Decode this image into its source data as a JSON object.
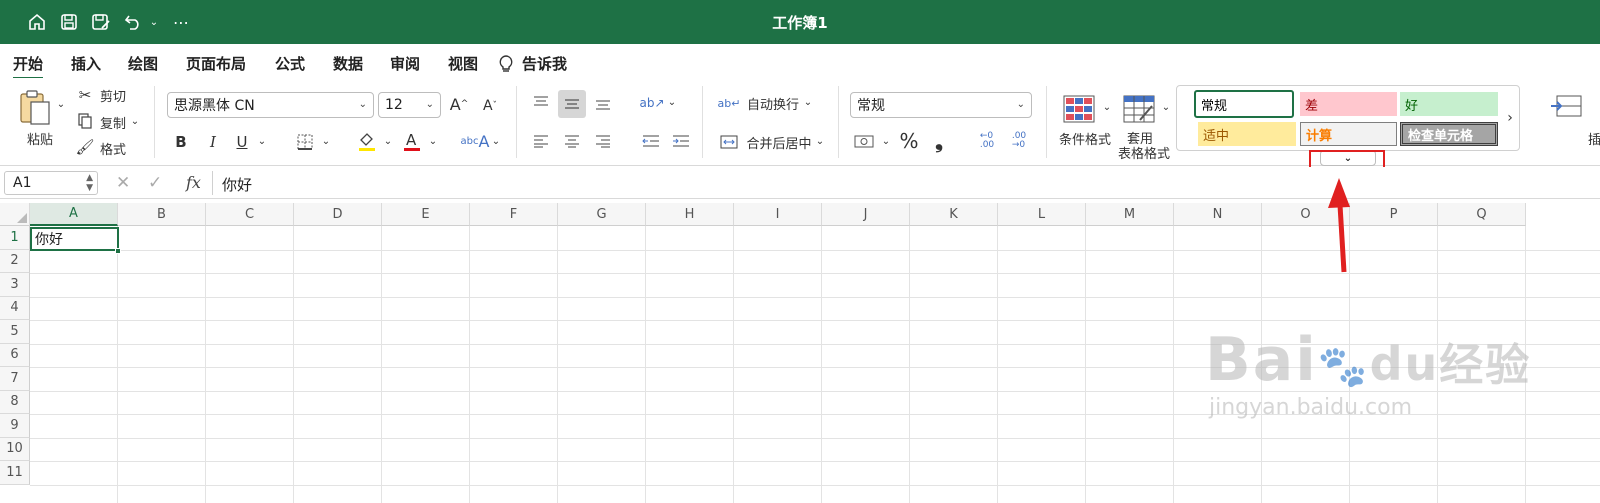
{
  "titlebar": {
    "title": "工作簿1",
    "quick_access": [
      "home-icon",
      "save-icon",
      "save-as-icon",
      "undo-icon",
      "more-icon"
    ]
  },
  "menu": {
    "tabs": [
      "开始",
      "插入",
      "绘图",
      "页面布局",
      "公式",
      "数据",
      "审阅",
      "视图"
    ],
    "tell_me": "告诉我",
    "active_index": 0
  },
  "ribbon": {
    "paste_label": "粘贴",
    "cut_label": "剪切",
    "copy_label": "复制",
    "format_painter_label": "格式",
    "font_name": "思源黑体 CN",
    "font_size": "12",
    "bold": "B",
    "italic": "I",
    "underline": "U",
    "wrap_text_label": "自动换行",
    "merge_center_label": "合并后居中",
    "number_format": "常规",
    "percent": "%",
    "comma": "❟",
    "conditional_format_label": "条件格式",
    "table_format_label_1": "套用",
    "table_format_label_2": "表格格式",
    "cell_styles": [
      {
        "label": "常规",
        "bg": "#ffffff",
        "fg": "#000000"
      },
      {
        "label": "差",
        "bg": "#ffc7ce",
        "fg": "#9c0006"
      },
      {
        "label": "好",
        "bg": "#c6efce",
        "fg": "#006100"
      },
      {
        "label": "适中",
        "bg": "#ffeb9c",
        "fg": "#9c5700"
      },
      {
        "label": "计算",
        "bg": "#f2f2f2",
        "fg": "#fa7d00"
      },
      {
        "label": "检查单元格",
        "bg": "#a5a5a5",
        "fg": "#ffffff"
      }
    ]
  },
  "formula_bar": {
    "name_box": "A1",
    "fx": "fx",
    "content": "你好"
  },
  "sheet": {
    "columns": [
      "A",
      "B",
      "C",
      "D",
      "E",
      "F",
      "G",
      "H",
      "I",
      "J",
      "K",
      "L",
      "M",
      "N",
      "O",
      "P",
      "Q"
    ],
    "rows": [
      "1",
      "2",
      "3",
      "4",
      "5",
      "6",
      "7",
      "8",
      "9",
      "10",
      "11"
    ],
    "active_cell": "A1",
    "a1_value": "你好"
  },
  "watermark": {
    "line1": "Bai",
    "line1b": "du",
    "line1c": "经验",
    "line2": "jingyan.baidu.com"
  },
  "colors": {
    "brand_green": "#1e7145",
    "annotation_red": "#e02020"
  }
}
